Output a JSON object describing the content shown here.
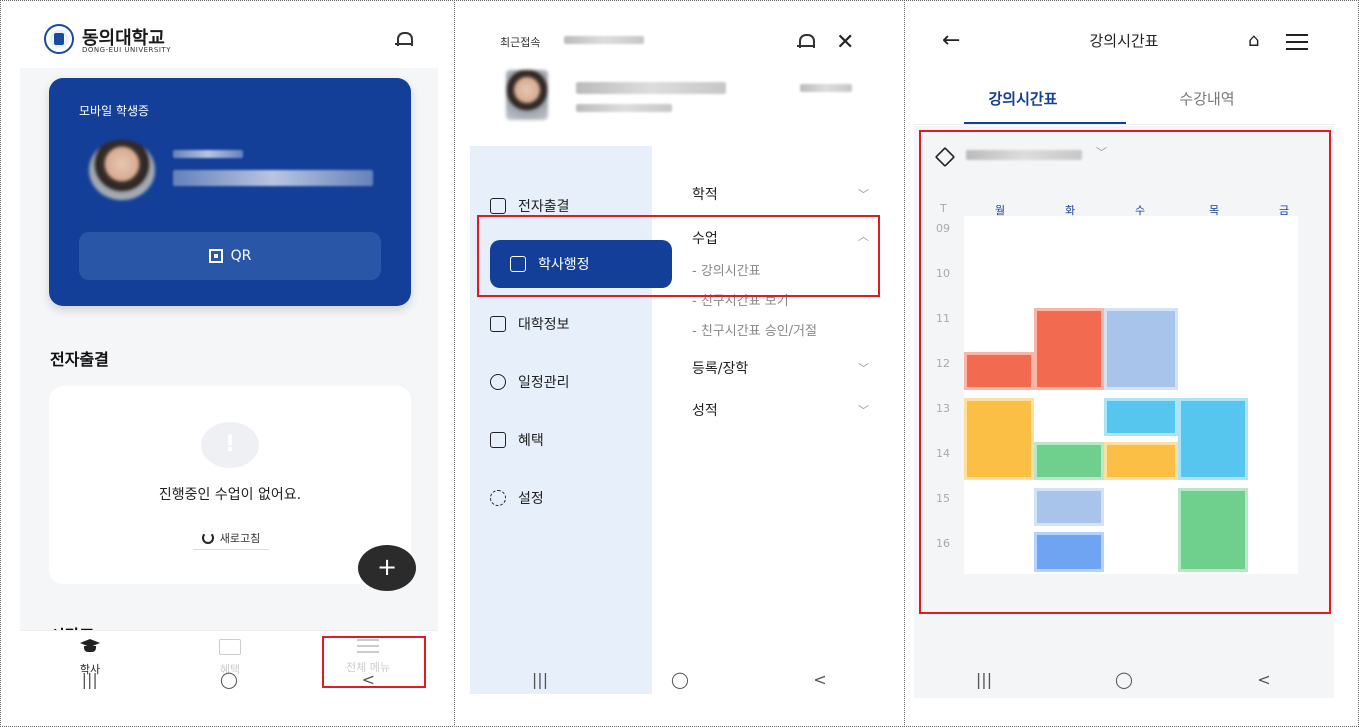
{
  "screen1": {
    "logo_kr": "동의대학교",
    "logo_en": "DONG-EUI UNIVERSITY",
    "card_title": "모바일 학생증",
    "qr_label": "QR",
    "section_attendance": "전자출결",
    "empty_message": "진행중인 수업이 없어요.",
    "refresh_label": "새로고침",
    "fab_label": "+",
    "section_cut": "시간표",
    "tabs": [
      {
        "label": "학사",
        "icon": "graduation-cap-icon"
      },
      {
        "label": "혜택",
        "icon": "gift-icon"
      },
      {
        "label": "전체 메뉴",
        "icon": "menu-icon"
      }
    ]
  },
  "screen2": {
    "recent_label": "최근접속",
    "side_menu": [
      {
        "label": "전자출결",
        "icon": "scroll-icon"
      },
      {
        "label": "학사행정",
        "icon": "archive-icon"
      },
      {
        "label": "대학정보",
        "icon": "school-icon"
      },
      {
        "label": "일정관리",
        "icon": "alarm-icon"
      },
      {
        "label": "혜택",
        "icon": "gift-icon"
      },
      {
        "label": "설정",
        "icon": "gear-icon"
      }
    ],
    "sub_groups": [
      "학적",
      "수업",
      "등록/장학",
      "성적"
    ],
    "sub_links": [
      "- 강의시간표",
      "- 친구시간표 보기",
      "- 친구시간표 승인/거절"
    ]
  },
  "screen3": {
    "title": "강의시간표",
    "tabs": [
      "강의시간표",
      "수강내역"
    ],
    "time_header": "T",
    "days": [
      "월",
      "화",
      "수",
      "목",
      "금"
    ],
    "hours": [
      "09",
      "10",
      "11",
      "12",
      "13",
      "14",
      "15",
      "16"
    ]
  },
  "nav_bar": {
    "recent": "|||",
    "home": "◯",
    "back": "<"
  },
  "colors": {
    "brand_blue": "#143f98",
    "highlight_red": "#e01b22",
    "block_red": "#f26b50",
    "block_blue_light": "#a9c4ea",
    "block_cyan": "#56c6ef",
    "block_yellow": "#fbbf45",
    "block_green": "#6fcf8c",
    "block_blue": "#6fa4f2"
  }
}
